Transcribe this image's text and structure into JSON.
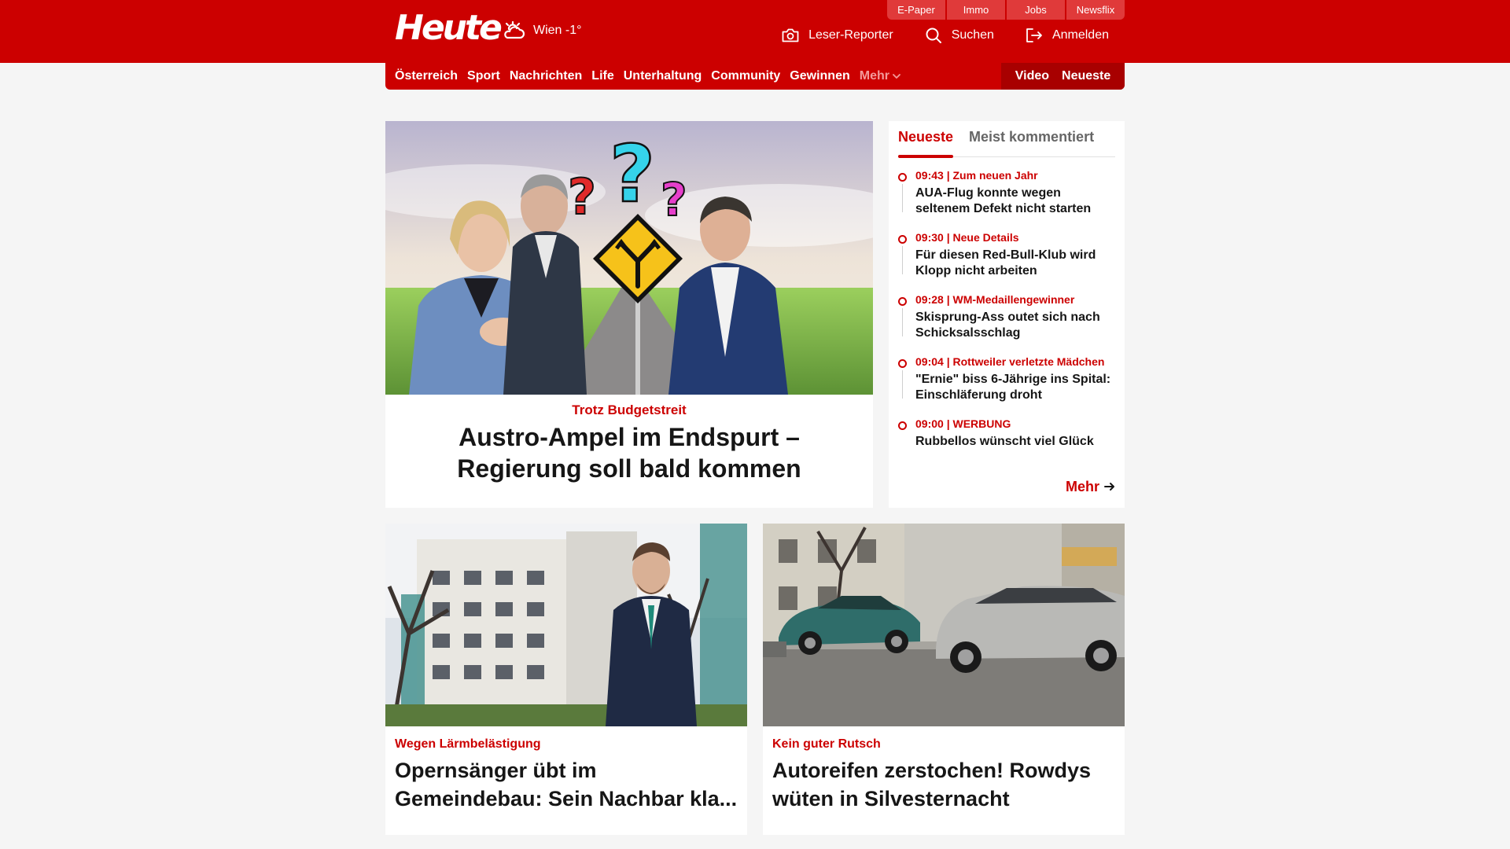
{
  "header": {
    "logo": "Heute",
    "weather": "Wien -1°",
    "service_links": [
      "E-Paper",
      "Immo",
      "Jobs",
      "Newsflix"
    ],
    "actions": {
      "reporter": "Leser-Reporter",
      "search": "Suchen",
      "login": "Anmelden"
    }
  },
  "nav": {
    "items": [
      "Österreich",
      "Sport",
      "Nachrichten",
      "Life",
      "Unterhaltung",
      "Community",
      "Gewinnen"
    ],
    "more": "Mehr",
    "video": "Video",
    "latest": "Neueste"
  },
  "hero": {
    "kicker": "Trotz Budgetstreit",
    "headline": "Austro-Ampel im Endspurt – Regierung soll bald kommen"
  },
  "sidebar": {
    "tabs": [
      "Neueste",
      "Meist kommentiert"
    ],
    "items": [
      {
        "meta": "09:43 | Zum neuen Jahr",
        "title": "AUA-Flug konnte wegen seltenem Defekt nicht starten"
      },
      {
        "meta": "09:30 | Neue Details",
        "title": "Für diesen Red-Bull-Klub wird Klopp nicht arbeiten"
      },
      {
        "meta": "09:28 | WM-Medaillengewinner",
        "title": "Skisprung-Ass outet sich nach Schicksalsschlag"
      },
      {
        "meta": "09:04 | Rottweiler verletzte Mädchen",
        "title": "\"Ernie\" biss 6-Jährige ins Spital: Einschläferung droht"
      },
      {
        "meta": "09:00 | WERBUNG",
        "title": "Rubbellos wünscht viel Glück"
      }
    ],
    "more": "Mehr"
  },
  "cards": [
    {
      "kicker": "Wegen Lärmbelästigung",
      "headline": "Opernsänger übt im Gemeindebau: Sein Nachbar kla..."
    },
    {
      "kicker": "Kein guter Rutsch",
      "headline": "Autoreifen zerstochen! Rowdys wüten in Silvesternacht"
    }
  ],
  "colors": {
    "brand_red": "#cc0000",
    "dark_red": "#a80000",
    "text": "#161616",
    "background": "#f5f5f5"
  }
}
